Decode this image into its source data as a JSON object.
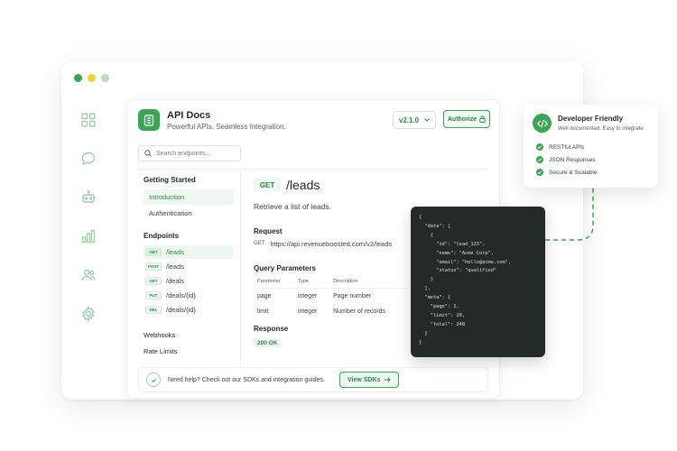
{
  "window": {
    "dots": [
      "#3aa553",
      "#f2d23c",
      "#b9dcc3"
    ]
  },
  "rail": {
    "icons": [
      "grid-icon",
      "chat-icon",
      "bot-icon",
      "bar-chart-icon",
      "users-icon",
      "settings-icon"
    ]
  },
  "header": {
    "title": "API Docs",
    "subtitle": "Powerful APIs. Seamless Integration.",
    "version": "v2.1.0",
    "authorize": "Authorize"
  },
  "search": {
    "placeholder": "Search endpoints..."
  },
  "sidebar": {
    "getting_started": "Getting Started",
    "introduction": "Introduction",
    "authentication": "Authentication",
    "endpoints_heading": "Endpoints",
    "endpoints": [
      {
        "method": "GET",
        "path": "/leads"
      },
      {
        "method": "POST",
        "path": "/leads"
      },
      {
        "method": "GET",
        "path": "/deals"
      },
      {
        "method": "PUT",
        "path": "/deals/{id}"
      },
      {
        "method": "DEL",
        "path": "/deals/{id}"
      }
    ],
    "webhooks": "Webhooks",
    "rate_limits": "Rate Limits"
  },
  "main": {
    "method": "GET",
    "path": "/leads",
    "description": "Retrieve a list of leads.",
    "request_heading": "Request",
    "request_method": "GET",
    "request_url": "https://api.revenueboosted.com/v2/leads",
    "query_heading": "Query Parameters",
    "table_headers": [
      "Parameter",
      "Type",
      "Description"
    ],
    "table_rows": [
      [
        "page",
        "integer",
        "Page number"
      ],
      [
        "limit",
        "integer",
        "Number of records"
      ]
    ],
    "response_heading": "Response",
    "response_status": "200 OK"
  },
  "footer": {
    "text": "Need help? Check out our SDKs and integration guides.",
    "button": "View SDKs"
  },
  "code_sample": "{\n  \"data\": [\n    {\n      \"id\": \"lead_123\",\n      \"name\": \"Acme Corp\",\n      \"email\": \"hello@acme.com\",\n      \"status\": \"qualified\"\n    }\n  ],\n  \"meta\": {\n    \"page\": 1,\n    \"limit\": 20,\n    \"total\": 248\n  }\n}",
  "card": {
    "title": "Developer Friendly",
    "subtitle": "Well documented. Easy to integrate.",
    "features": [
      "RESTful APIs",
      "JSON Responses",
      "Secure & Scalable"
    ]
  },
  "colors": {
    "accent": "#3aa553",
    "code_bg": "#242a28"
  }
}
